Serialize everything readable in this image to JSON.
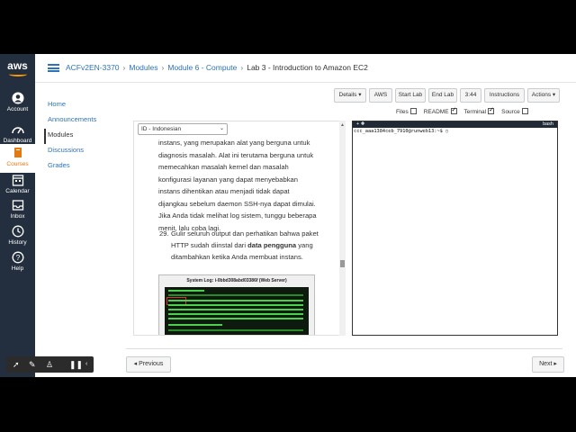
{
  "global_nav": {
    "logo": "aws",
    "items": [
      {
        "label": "Account",
        "icon": "account-icon"
      },
      {
        "label": "Dashboard",
        "icon": "dashboard-icon"
      },
      {
        "label": "Courses",
        "icon": "courses-icon"
      },
      {
        "label": "Calendar",
        "icon": "calendar-icon"
      },
      {
        "label": "Inbox",
        "icon": "inbox-icon"
      },
      {
        "label": "History",
        "icon": "history-icon"
      },
      {
        "label": "Help",
        "icon": "help-icon"
      }
    ]
  },
  "breadcrumb": {
    "items": [
      "ACFv2EN-3370",
      "Modules",
      "Module 6 - Compute"
    ],
    "current": "Lab 3 - Introduction to Amazon EC2"
  },
  "course_nav": {
    "items": [
      "Home",
      "Announcements",
      "Modules",
      "Discussions",
      "Grades"
    ],
    "active": "Modules"
  },
  "toolbar": {
    "details": "Details ▾",
    "aws": "AWS",
    "start_lab": "Start Lab",
    "end_lab": "End Lab",
    "timer": "3:44",
    "instructions": "Instructions",
    "actions": "Actions ▾"
  },
  "view_options": {
    "files": "Files",
    "readme": "README",
    "terminal": "Terminal",
    "source": "Source",
    "files_checked": false,
    "readme_checked": true,
    "terminal_checked": true,
    "source_checked": false
  },
  "content": {
    "language": "ID - Indonesian",
    "paragraph": "instans, yang merupakan alat yang berguna untuk diagnosis masalah. Alat ini terutama berguna untuk memecahkan masalah kernel dan masalah konfigurasi layanan yang dapat menyebabkan instans dihentikan atau menjadi tidak dapat dijangkau sebelum daemon SSH-nya dapat dimulai. Jika Anda tidak melihat log sistem, tunggu beberapa menit, lalu coba lagi.",
    "step_number": "29.",
    "step_text_1": "Gulir seluruh output dan perhatikan bahwa paket HTTP sudah diinstal dari ",
    "step_bold": "data pengguna",
    "step_text_2": " yang ditambahkan ketika Anda membuat instans.",
    "screenshot_title": "System Log: i-0bbd308abd03386f (Web Server)"
  },
  "terminal": {
    "tab": "bash",
    "prompt": "ccc_aaa1384ceb_7910@runweb13:~$"
  },
  "pager": {
    "previous": "◂ Previous",
    "next": "Next ▸"
  },
  "colors": {
    "nav_bg": "#232f3e",
    "link": "#2d73b8",
    "aws_orange": "#ff9900",
    "active_orange": "#e47911"
  }
}
